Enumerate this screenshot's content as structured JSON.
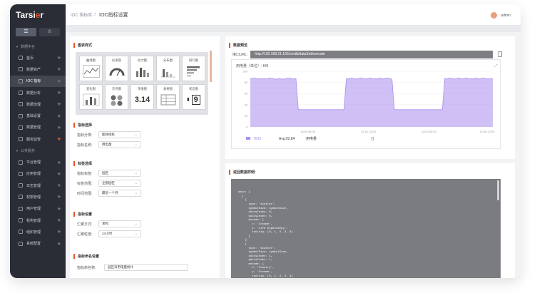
{
  "app": {
    "logo_main": "Tarsi",
    "logo_accent": "e",
    "logo_end": "r"
  },
  "sidebar": {
    "tab_list_icon": "☰",
    "tab_star_icon": "☆",
    "section1": "数据中台",
    "section2": "公共服务",
    "items1": [
      {
        "label": "首页",
        "starred": false,
        "active": false
      },
      {
        "label": "数据资产",
        "starred": false,
        "active": false
      },
      {
        "label": "IOC 指标",
        "starred": false,
        "active": true
      },
      {
        "label": "数据分析",
        "starred": false,
        "active": false
      },
      {
        "label": "数据治理",
        "starred": false,
        "active": false
      },
      {
        "label": "基础设置",
        "starred": false,
        "active": false
      },
      {
        "label": "数据管理",
        "starred": false,
        "active": false
      },
      {
        "label": "服务监管",
        "starred": true,
        "active": false
      }
    ],
    "items2": [
      {
        "label": "平台管理",
        "starred": false
      },
      {
        "label": "应用管理",
        "starred": false
      },
      {
        "label": "日志管理",
        "starred": false
      },
      {
        "label": "权限管理",
        "starred": false
      },
      {
        "label": "用户管理",
        "starred": false
      },
      {
        "label": "机构管理",
        "starred": false
      },
      {
        "label": "组织管理",
        "starred": false
      },
      {
        "label": "系统配置",
        "starred": false
      }
    ]
  },
  "topbar": {
    "breadcrumb_parent": "IOC 指标库",
    "separator": "/",
    "breadcrumb_current": "IOC指标设置",
    "user": "admin"
  },
  "left": {
    "chart_style_title": "图表样式",
    "chart_types": [
      {
        "label": "曲线图",
        "kind": "line"
      },
      {
        "label": "仪表盘",
        "kind": "gauge"
      },
      {
        "label": "柱力图",
        "kind": "bars"
      },
      {
        "label": "分布图",
        "kind": "dist"
      },
      {
        "label": "排行图",
        "kind": "rank"
      },
      {
        "label": "变化图",
        "kind": "change"
      },
      {
        "label": "示点图",
        "kind": "dots"
      },
      {
        "label": "单值图",
        "kind": "value",
        "value": "3.14"
      },
      {
        "label": "表格图",
        "kind": "table"
      },
      {
        "label": "状态图",
        "kind": "state",
        "value": "9"
      }
    ],
    "metric_section": "指标选择",
    "metric_fields": [
      {
        "label": "指标分类:",
        "value": "能耗指标"
      },
      {
        "label": "指标名称:",
        "value": "用电量"
      }
    ],
    "tag_section": "标签选择",
    "tag_fields": [
      {
        "label": "指标标签:",
        "value": "园区"
      },
      {
        "label": "标签范围:",
        "value": "全部园区"
      },
      {
        "label": "时间范围:",
        "value": "最近一个月"
      }
    ],
    "agg_section": "指标设置",
    "agg_fields": [
      {
        "label": "汇聚方式:",
        "value": "求和"
      },
      {
        "label": "汇聚粒度:",
        "value": "24小时"
      }
    ],
    "name_section": "指标命名设置",
    "name_label": "指标命名称:",
    "name_value": "园区日用电量统计"
  },
  "right": {
    "preview_title": "数据预览",
    "url_label": "接口URL:",
    "url_value": "http://192.168.21.162/cmdb/dataSet/execute",
    "chart_header": "用电量（单位）: KM",
    "expand_icon": "⤢",
    "legend_name": "7635",
    "legend_stat_label": "Avg:92.84",
    "legend_metric": "用电量",
    "legend_right": "{}",
    "code_title": "返回数据样例:",
    "code_lines": [
      "data: [",
      "  {",
      "    {",
      "      type: 'scatter',",
      "      symbolSize: symbolSize,",
      "      xAxisIndex: 0,",
      "      yAxisIndex: 0,",
      "      encode: {",
      "        x: 'Income',",
      "        y: 'Life Expectancy',",
      "        tooltip: [0, 1, 2, 3, 4]",
      "      }",
      "    },",
      "    {",
      "      type: 'scatter',",
      "      symbolSize: symbolSize,",
      "      xAxisIndex: 1,",
      "      yAxisIndex: 1,",
      "      encode: {",
      "        x: 'Country',",
      "        y: 'Income',",
      "        tooltip: [0, 1, 2, 3, 4]",
      "      }"
    ]
  },
  "chart_data": {
    "type": "area",
    "title": "用电量（单位）: KM",
    "yticks": [
      "100",
      "80",
      "60",
      "40",
      "20",
      "0"
    ],
    "ylim": [
      0,
      100
    ],
    "xticks": [
      "11/08 00:00",
      "11/10 12:00",
      "11/10 00:00",
      "11/08 12:00"
    ],
    "series": [
      {
        "name": "7635",
        "color": "#a98ded",
        "values": [
          88,
          87,
          88,
          86,
          87,
          86,
          87,
          86,
          88,
          87,
          86,
          86,
          87,
          86,
          86,
          87,
          88,
          87,
          86,
          87,
          31,
          31,
          31,
          31,
          31,
          31,
          31,
          31,
          31,
          31,
          31,
          31,
          31,
          31,
          31,
          31,
          31,
          31,
          31,
          31,
          87,
          86,
          88,
          87,
          86,
          87,
          88,
          87,
          86,
          87,
          88,
          86,
          87,
          86,
          88,
          86,
          87,
          88,
          87,
          86,
          31,
          31,
          31,
          31,
          31,
          31,
          31,
          31,
          31,
          31,
          31,
          31,
          31,
          31,
          31,
          31,
          31,
          31,
          31,
          31,
          31,
          87,
          86,
          88,
          87,
          86,
          87,
          88,
          86,
          87,
          88,
          86,
          87,
          86,
          88,
          86,
          87,
          88,
          87,
          86,
          87,
          86
        ]
      }
    ]
  },
  "colors": {
    "accent": "#e8542f",
    "sidebar": "#2a2d35",
    "area": "#a98ded"
  }
}
